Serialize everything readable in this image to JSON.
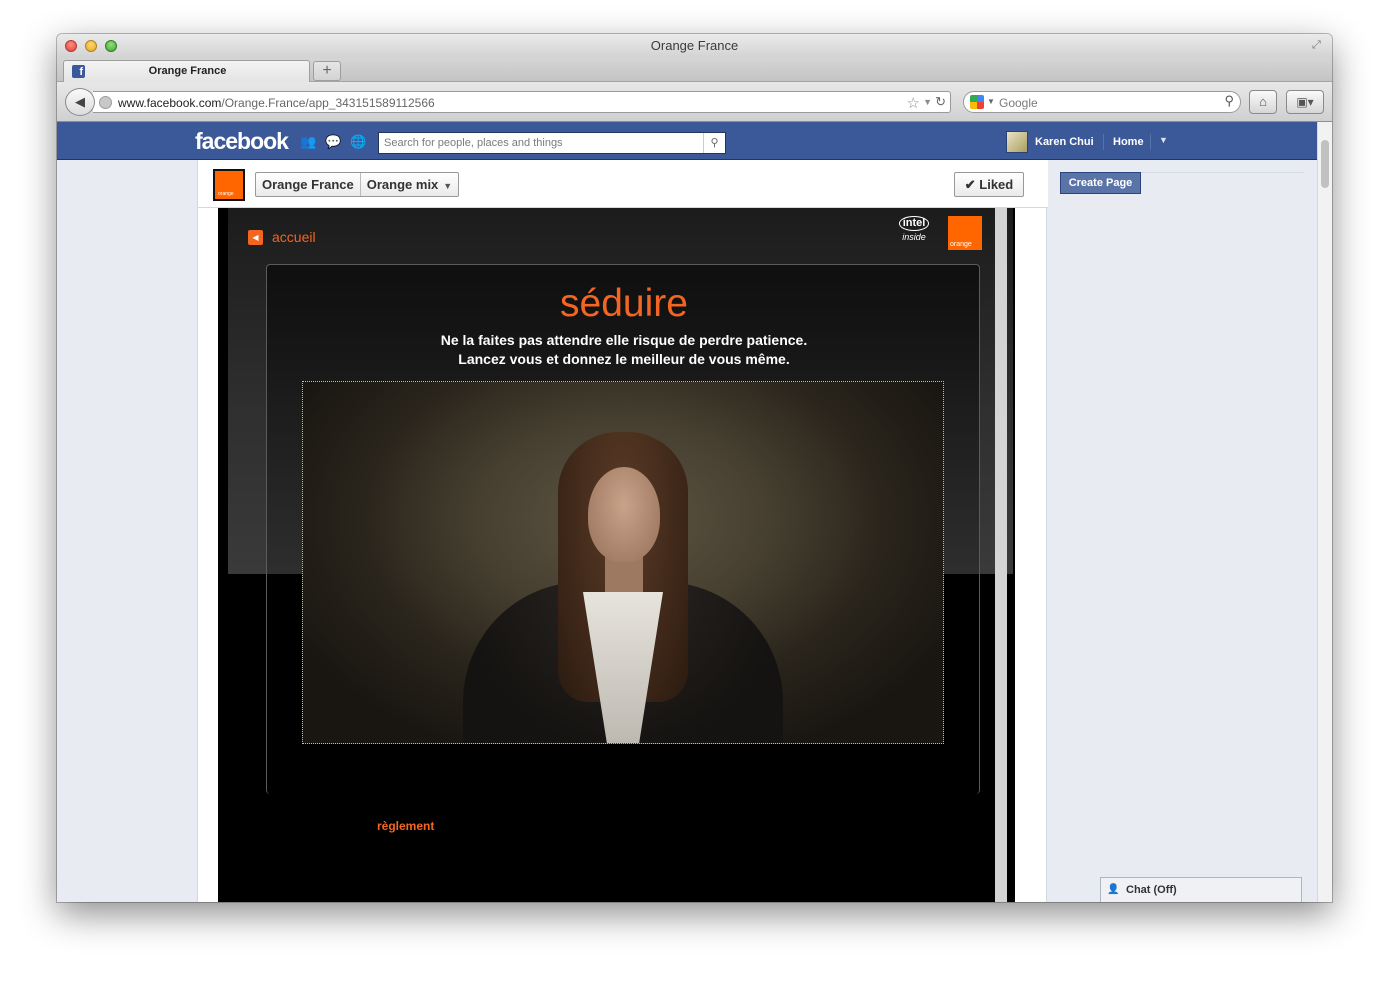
{
  "window": {
    "title": "Orange France"
  },
  "tabs": [
    {
      "label": "Orange France",
      "favicon": "facebook-f-icon"
    }
  ],
  "browser": {
    "new_tab_label": "+",
    "url_domain": "www.facebook.com",
    "url_path": "/Orange.France/app_343151589112566",
    "search_placeholder": "Google",
    "icons": [
      "back-arrow-icon",
      "globe-icon",
      "star-icon",
      "reload-icon",
      "google-icon",
      "magnifier-icon",
      "home-icon",
      "bookmarks-icon"
    ]
  },
  "facebook": {
    "logo": "facebook",
    "search_placeholder": "Search for people, places and things",
    "user_name": "Karen Chui",
    "home_label": "Home",
    "brand_color": "#3b5998"
  },
  "page": {
    "breadcrumb": [
      "Orange France",
      "Orange mix"
    ],
    "liked_label": "Liked",
    "thumb_text": "orange"
  },
  "app": {
    "back_label": "accueil",
    "intel_label": "intel",
    "intel_inside": "inside",
    "orange_label": "orange",
    "title": "séduire",
    "line1": "Ne la faites pas attendre elle risque de perdre patience.",
    "line2": "Lancez vous et donnez le meilleur de vous même.",
    "rules_link": "règlement",
    "accent_color": "#f26522"
  },
  "sidebar": {
    "create_page_label": "Create Page",
    "chat_label": "Chat (Off)"
  }
}
